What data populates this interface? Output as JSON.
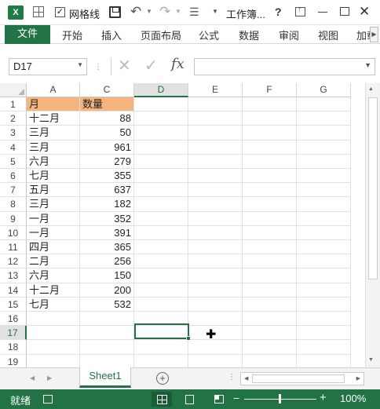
{
  "titlebar": {
    "app_badge": "X",
    "gridlines_check": "✓",
    "gridlines_label": "网格线",
    "doc_title": "工作簿...",
    "help": "?",
    "icons": [
      "excel-icon",
      "grid-icon",
      "save-icon",
      "undo-icon",
      "redo-icon",
      "customize-icon",
      "help-icon",
      "ribbon-options-icon",
      "minimize-icon",
      "maximize-icon",
      "close-icon"
    ]
  },
  "ribbon": {
    "file": "文件",
    "tabs": [
      "开始",
      "插入",
      "页面布局",
      "公式",
      "数据",
      "审阅",
      "视图",
      "加载"
    ]
  },
  "formula_bar": {
    "name_box": "D17",
    "fx": "fx",
    "value": ""
  },
  "sheet": {
    "columns": [
      "A",
      "C",
      "D",
      "E",
      "F",
      "G"
    ],
    "active_column": "D",
    "active_row": 17,
    "row_numbers": [
      "1",
      "2",
      "3",
      "4",
      "5",
      "6",
      "7",
      "8",
      "9",
      "10",
      "11",
      "12",
      "13",
      "14",
      "15",
      "16",
      "17",
      "18",
      "19"
    ],
    "header": {
      "month": "月",
      "quantity": "数量"
    },
    "rows": [
      {
        "month": "十二月",
        "quantity": "88"
      },
      {
        "month": "三月",
        "quantity": "50"
      },
      {
        "month": "三月",
        "quantity": "961"
      },
      {
        "month": "六月",
        "quantity": "279"
      },
      {
        "month": "七月",
        "quantity": "355"
      },
      {
        "month": "五月",
        "quantity": "637"
      },
      {
        "month": "三月",
        "quantity": "182"
      },
      {
        "month": "一月",
        "quantity": "352"
      },
      {
        "month": "一月",
        "quantity": "391"
      },
      {
        "month": "四月",
        "quantity": "365"
      },
      {
        "month": "二月",
        "quantity": "256"
      },
      {
        "month": "六月",
        "quantity": "150"
      },
      {
        "month": "十二月",
        "quantity": "200"
      },
      {
        "month": "七月",
        "quantity": "532"
      }
    ],
    "header_fill": "#f5b47c",
    "accent": "#217346"
  },
  "sheet_tabs": {
    "active": "Sheet1",
    "add": "+"
  },
  "status_bar": {
    "ready": "就绪",
    "zoom_out": "−",
    "zoom_in": "+",
    "zoom": "100%"
  }
}
